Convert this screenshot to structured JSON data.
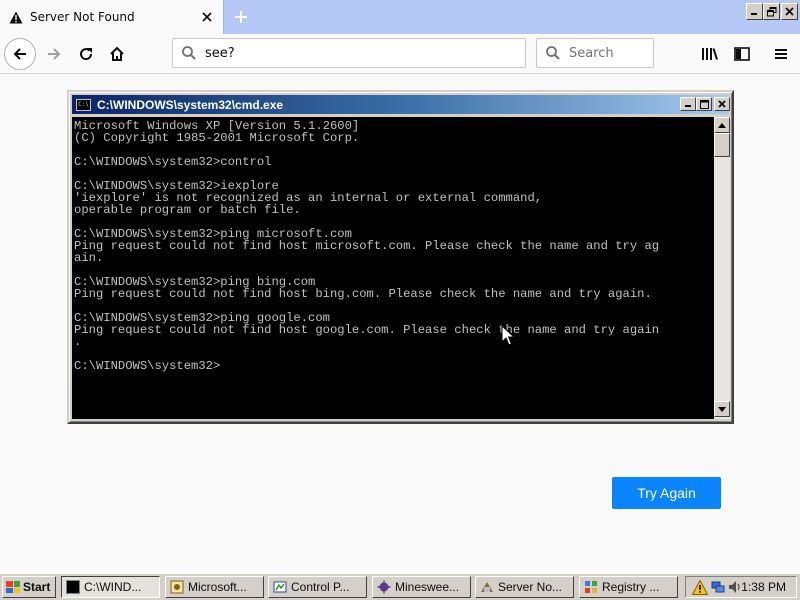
{
  "browser": {
    "tab_title": "Server Not Found",
    "url": "see?",
    "search_placeholder": "Search"
  },
  "cmd": {
    "title": "C:\\WINDOWS\\system32\\cmd.exe",
    "icon_text": "C:\\",
    "lines": [
      "Microsoft Windows XP [Version 5.1.2600]",
      "(C) Copyright 1985-2001 Microsoft Corp.",
      "",
      "C:\\WINDOWS\\system32>control",
      "",
      "C:\\WINDOWS\\system32>iexplore",
      "'iexplore' is not recognized as an internal or external command,",
      "operable program or batch file.",
      "",
      "C:\\WINDOWS\\system32>ping microsoft.com",
      "Ping request could not find host microsoft.com. Please check the name and try ag",
      "ain.",
      "",
      "C:\\WINDOWS\\system32>ping bing.com",
      "Ping request could not find host bing.com. Please check the name and try again.",
      "",
      "C:\\WINDOWS\\system32>ping google.com",
      "Ping request could not find host google.com. Please check the name and try again",
      ".",
      "",
      "C:\\WINDOWS\\system32>"
    ]
  },
  "page": {
    "try_again_label": "Try Again"
  },
  "taskbar": {
    "start_label": "Start",
    "tasks": [
      "C:\\WIND...",
      "Microsoft...",
      "Control P...",
      "Minesweе...",
      "Server No...",
      "Registry ..."
    ],
    "clock": "1:38 PM"
  },
  "colors": {
    "accent": "#0a84ff",
    "titlebar": "#0a246a",
    "console_text": "#c0c0c0"
  }
}
